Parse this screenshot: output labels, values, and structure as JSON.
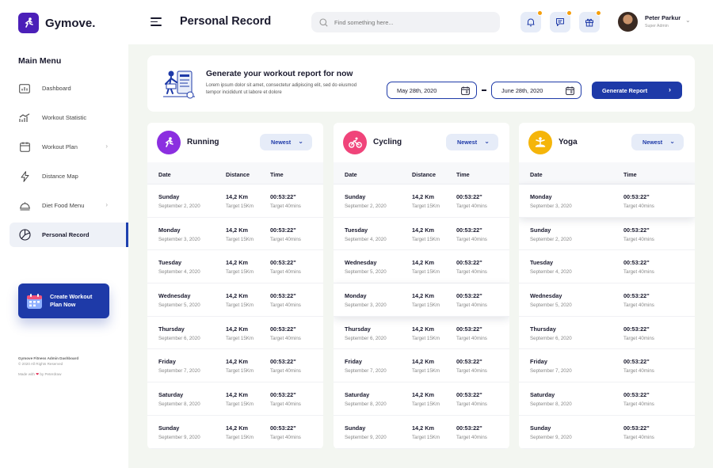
{
  "brand": {
    "name": "Gymove."
  },
  "sidebar": {
    "menu_title": "Main Menu",
    "items": [
      {
        "label": "Dashboard",
        "icon": "chart-icon",
        "chevron": false,
        "active": false
      },
      {
        "label": "Workout Statistic",
        "icon": "trend-icon",
        "chevron": false,
        "active": false
      },
      {
        "label": "Workout Plan",
        "icon": "calendar-icon",
        "chevron": true,
        "active": false
      },
      {
        "label": "Distance Map",
        "icon": "lightning-icon",
        "chevron": false,
        "active": false
      },
      {
        "label": "Diet Food Menu",
        "icon": "dish-icon",
        "chevron": true,
        "active": false
      },
      {
        "label": "Personal Record",
        "icon": "pie-icon",
        "chevron": false,
        "active": true
      }
    ],
    "cta_label": "Create Workout Plan Now",
    "footer_line1": "Gymove Fitness Admin Dashboard",
    "footer_line2": "© 2020 All Rights Reserved",
    "footer_made": "Made with",
    "footer_by": "by Peterdraw"
  },
  "topbar": {
    "title": "Personal Record",
    "search_placeholder": "Find something here...",
    "user_name": "Peter Parkur",
    "user_role": "Super Admin"
  },
  "banner": {
    "title": "Generate your workout report for now",
    "desc": "Lorem ipsum dolor sit amet, consectetur adipiscing elit, sed do eiusmod tempor incididunt ut labore et dolore",
    "date_from": "May 28th, 2020",
    "date_to": "June 28th, 2020",
    "button": "Generate Report"
  },
  "colors": {
    "primary": "#1e3aa8",
    "running": "#8b2fe0",
    "cycling": "#f0447a",
    "yoga": "#f5b50a",
    "badge": "#f59e0b"
  },
  "cards": [
    {
      "name": "Running",
      "sort": "Newest",
      "headers": [
        "Date",
        "Distance",
        "Time"
      ],
      "rows": [
        {
          "day": "Sunday",
          "date": "September 2, 2020",
          "dist": "14,2 Km",
          "target": "Target 15Km",
          "time": "00:53:22\"",
          "target_time": "Target 40mins"
        },
        {
          "day": "Monday",
          "date": "September 3, 2020",
          "dist": "14,2 Km",
          "target": "Target 15Km",
          "time": "00:53:22\"",
          "target_time": "Target 40mins"
        },
        {
          "day": "Tuesday",
          "date": "September 4, 2020",
          "dist": "14,2 Km",
          "target": "Target 15Km",
          "time": "00:53:22\"",
          "target_time": "Target 40mins"
        },
        {
          "day": "Wednesday",
          "date": "September 5, 2020",
          "dist": "14,2 Km",
          "target": "Target 15Km",
          "time": "00:53:22\"",
          "target_time": "Target 40mins"
        },
        {
          "day": "Thursday",
          "date": "September 6, 2020",
          "dist": "14,2 Km",
          "target": "Target 15Km",
          "time": "00:53:22\"",
          "target_time": "Target 40mins"
        },
        {
          "day": "Friday",
          "date": "September 7, 2020",
          "dist": "14,2 Km",
          "target": "Target 15Km",
          "time": "00:53:22\"",
          "target_time": "Target 40mins"
        },
        {
          "day": "Saturday",
          "date": "September 8, 2020",
          "dist": "14,2 Km",
          "target": "Target 15Km",
          "time": "00:53:22\"",
          "target_time": "Target 40mins"
        },
        {
          "day": "Sunday",
          "date": "September 9, 2020",
          "dist": "14,2 Km",
          "target": "Target 15Km",
          "time": "00:53:22\"",
          "target_time": "Target 40mins"
        }
      ]
    },
    {
      "name": "Cycling",
      "sort": "Newest",
      "headers": [
        "Date",
        "Distance",
        "Time"
      ],
      "rows": [
        {
          "day": "Sunday",
          "date": "September 2, 2020",
          "dist": "14,2 Km",
          "target": "Target 15Km",
          "time": "00:53:22\"",
          "target_time": "Target 40mins"
        },
        {
          "day": "Tuesday",
          "date": "September 4, 2020",
          "dist": "14,2 Km",
          "target": "Target 15Km",
          "time": "00:53:22\"",
          "target_time": "Target 40mins"
        },
        {
          "day": "Wednesday",
          "date": "September 5, 2020",
          "dist": "14,2 Km",
          "target": "Target 15Km",
          "time": "00:53:22\"",
          "target_time": "Target 40mins"
        },
        {
          "day": "Monday",
          "date": "September 3, 2020",
          "dist": "14,2 Km",
          "target": "Target 15Km",
          "time": "00:53:22\"",
          "target_time": "Target 40mins"
        },
        {
          "day": "Thursday",
          "date": "September 6, 2020",
          "dist": "14,2 Km",
          "target": "Target 15Km",
          "time": "00:53:22\"",
          "target_time": "Target 40mins"
        },
        {
          "day": "Friday",
          "date": "September 7, 2020",
          "dist": "14,2 Km",
          "target": "Target 15Km",
          "time": "00:53:22\"",
          "target_time": "Target 40mins"
        },
        {
          "day": "Saturday",
          "date": "September 8, 2020",
          "dist": "14,2 Km",
          "target": "Target 15Km",
          "time": "00:53:22\"",
          "target_time": "Target 40mins"
        },
        {
          "day": "Sunday",
          "date": "September 9, 2020",
          "dist": "14,2 Km",
          "target": "Target 15Km",
          "time": "00:53:22\"",
          "target_time": "Target 40mins"
        }
      ]
    },
    {
      "name": "Yoga",
      "sort": "Newest",
      "headers": [
        "Date",
        "Time"
      ],
      "rows": [
        {
          "day": "Monday",
          "date": "September 3, 2020",
          "time": "00:53:22\"",
          "target_time": "Target 40mins"
        },
        {
          "day": "Sunday",
          "date": "September 2, 2020",
          "time": "00:53:22\"",
          "target_time": "Target 40mins"
        },
        {
          "day": "Tuesday",
          "date": "September 4, 2020",
          "time": "00:53:22\"",
          "target_time": "Target 40mins"
        },
        {
          "day": "Wednesday",
          "date": "September 5, 2020",
          "time": "00:53:22\"",
          "target_time": "Target 40mins"
        },
        {
          "day": "Thursday",
          "date": "September 6, 2020",
          "time": "00:53:22\"",
          "target_time": "Target 40mins"
        },
        {
          "day": "Friday",
          "date": "September 7, 2020",
          "time": "00:53:22\"",
          "target_time": "Target 40mins"
        },
        {
          "day": "Saturday",
          "date": "September 8, 2020",
          "time": "00:53:22\"",
          "target_time": "Target 40mins"
        },
        {
          "day": "Sunday",
          "date": "September 9, 2020",
          "time": "00:53:22\"",
          "target_time": "Target 40mins"
        }
      ]
    }
  ]
}
